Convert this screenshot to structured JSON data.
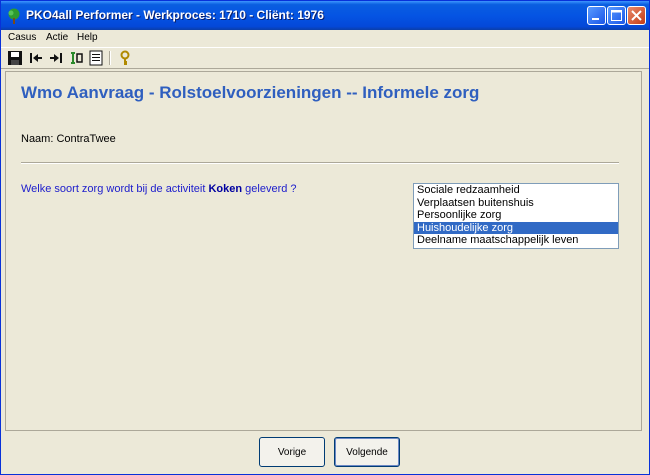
{
  "window": {
    "title": "PKO4all Performer - Werkproces: 1710 - Cliënt: 1976",
    "icon": "tree-icon",
    "controls": [
      "minimize-icon",
      "maximize-icon",
      "close-icon"
    ]
  },
  "menu": {
    "items": [
      {
        "label": "Casus"
      },
      {
        "label": "Actie"
      },
      {
        "label": "Help"
      }
    ]
  },
  "toolbar": {
    "icons": [
      "save-icon",
      "first-icon",
      "last-icon",
      "transfer-icon",
      "list-icon",
      "key-icon"
    ]
  },
  "form": {
    "heading": "Wmo Aanvraag - Rolstoelvoorzieningen -- Informele zorg",
    "name_label": "Naam:",
    "name_value": "ContraTwee",
    "question_before": "Welke soort zorg wordt bij de activiteit ",
    "question_bold": "Koken",
    "question_after": " geleverd ?",
    "options": [
      {
        "label": "Sociale redzaamheid",
        "selected": false
      },
      {
        "label": "Verplaatsen buitenshuis",
        "selected": false
      },
      {
        "label": "Persoonlijke zorg",
        "selected": false
      },
      {
        "label": "Huishoudelijke zorg",
        "selected": true
      },
      {
        "label": "Deelname maatschappelijk leven",
        "selected": false
      }
    ],
    "selected_color": "#316ac5"
  },
  "buttons": {
    "prev_label": "Vorige",
    "next_label": "Volgende"
  },
  "colors": {
    "heading": "#2f5fbf",
    "question": "#1d1dcc",
    "titlebar": "#0554e3"
  }
}
